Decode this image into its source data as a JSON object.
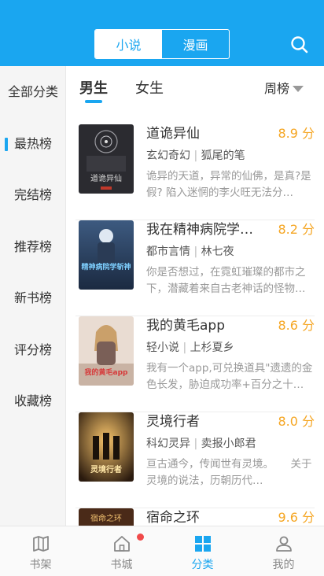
{
  "header": {
    "tabs": [
      {
        "label": "小说",
        "active": true
      },
      {
        "label": "漫画",
        "active": false
      }
    ],
    "search_icon": "search-icon",
    "accent_color": "#1aa6f0"
  },
  "sidebar": {
    "items": [
      {
        "label": "全部分类",
        "active": false
      },
      {
        "label": "最热榜",
        "active": true
      },
      {
        "label": "完结榜",
        "active": false
      },
      {
        "label": "推荐榜",
        "active": false
      },
      {
        "label": "新书榜",
        "active": false
      },
      {
        "label": "评分榜",
        "active": false
      },
      {
        "label": "收藏榜",
        "active": false
      }
    ]
  },
  "gender_tabs": [
    {
      "label": "男生",
      "active": true
    },
    {
      "label": "女生",
      "active": false
    }
  ],
  "rank_selector": {
    "label": "周榜"
  },
  "books": [
    {
      "title": "道诡异仙",
      "score": "8.9 分",
      "genre": "玄幻奇幻",
      "author": "狐尾的笔",
      "desc": "诡异的天道，异常的仙佛，是真?是假? 陷入迷惘的李火旺无法分…",
      "cover_text": "道诡异仙"
    },
    {
      "title": "我在精神病院学…",
      "score": "8.2 分",
      "genre": "都市言情",
      "author": "林七夜",
      "desc": "你是否想过，在霓虹璀璨的都市之下，潜藏着来自古老神话的怪物…",
      "cover_text": "精神病院学斩神"
    },
    {
      "title": "我的黄毛app",
      "score": "8.6 分",
      "genre": "轻小说",
      "author": "上杉夏乡",
      "desc": "我有一个app,可兑换道具\"遗遗的金色长发，胁迫成功率+百分之十…",
      "cover_text": "我的黄毛app"
    },
    {
      "title": "灵境行者",
      "score": "8.0 分",
      "genre": "科幻灵异",
      "author": "卖报小郎君",
      "desc": "亘古通今，传闻世有灵境。     关于灵境的说法，历朝历代…",
      "cover_text": "灵境行者"
    },
    {
      "title": "宿命之环",
      "score": "9.6 分",
      "genre": "",
      "author": "",
      "desc": "",
      "cover_text": "宿命之环"
    }
  ],
  "bottom_nav": {
    "items": [
      {
        "label": "书架",
        "icon": "bookshelf-icon",
        "active": false
      },
      {
        "label": "书城",
        "icon": "home-icon",
        "active": false,
        "badge": true
      },
      {
        "label": "分类",
        "icon": "category-icon",
        "active": true
      },
      {
        "label": "我的",
        "icon": "profile-icon",
        "active": false
      }
    ]
  },
  "colors": {
    "score": "#f5a623",
    "badge": "#f04a4a"
  }
}
